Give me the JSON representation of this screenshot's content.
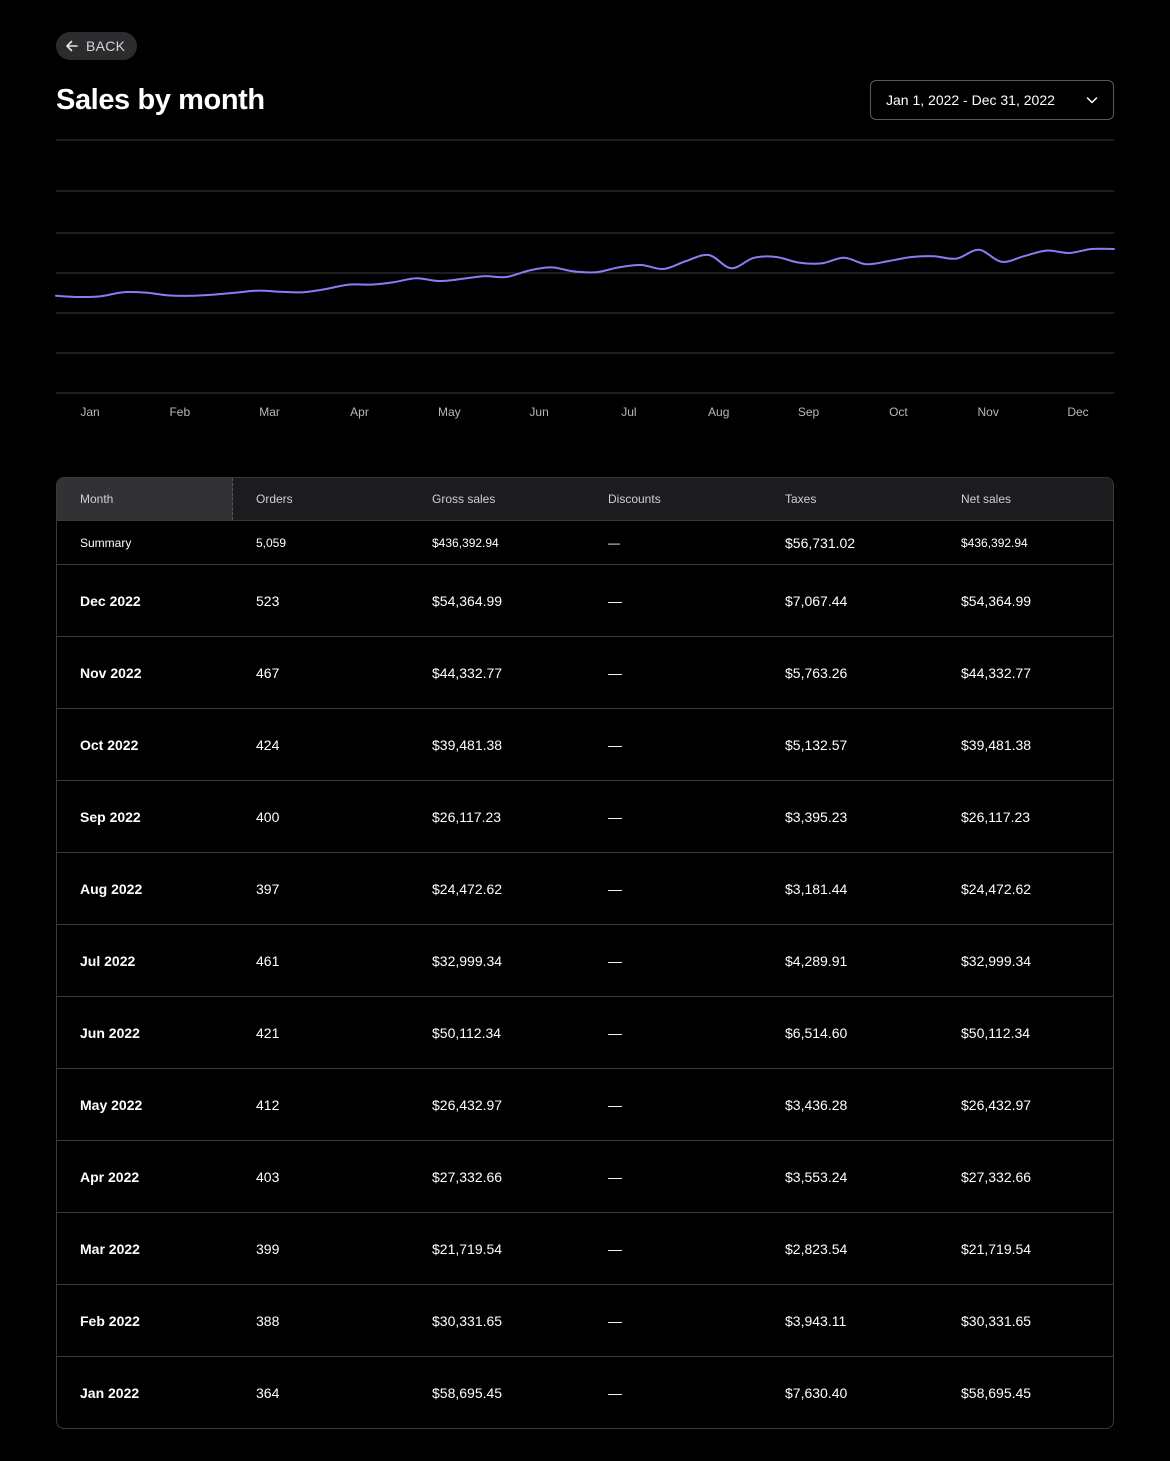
{
  "back": {
    "label": "BACK",
    "icon": "arrow-left-icon"
  },
  "page": {
    "title": "Sales by month"
  },
  "date_range": {
    "value": "Jan 1, 2022 - Dec 31, 2022",
    "icon": "chevron-down-icon"
  },
  "colors": {
    "line": "#8b7cf6",
    "grid": "#3a3a3e",
    "background": "#000000"
  },
  "chart_data": {
    "type": "line",
    "categories": [
      "Jan",
      "Feb",
      "Mar",
      "Apr",
      "May",
      "Jun",
      "Jul",
      "Aug",
      "Sep",
      "Oct",
      "Nov",
      "Dec"
    ],
    "grid": true,
    "xlabel": "",
    "ylabel": "",
    "series": [
      {
        "values": [
          0.43,
          0.4,
          0.42,
          0.52,
          0.51,
          0.44,
          0.43,
          0.46,
          0.51,
          0.56,
          0.53,
          0.52,
          0.6,
          0.71,
          0.71,
          0.77,
          0.87,
          0.8,
          0.85,
          0.92,
          0.9,
          1.06,
          1.14,
          1.04,
          1.02,
          1.14,
          1.2,
          1.1,
          1.3,
          1.45,
          1.12,
          1.38,
          1.4,
          1.26,
          1.24,
          1.38,
          1.22,
          1.3,
          1.4,
          1.42,
          1.36,
          1.58,
          1.28,
          1.42,
          1.56,
          1.5,
          1.6,
          1.6
        ]
      }
    ]
  },
  "table": {
    "headers": [
      "Month",
      "Orders",
      "Gross sales",
      "Discounts",
      "Taxes",
      "Net sales"
    ],
    "summary": [
      "Summary",
      "5,059",
      "$436,392.94",
      "—",
      "$56,731.02",
      "$436,392.94"
    ],
    "rows": [
      [
        "Dec 2022",
        "523",
        "$54,364.99",
        "—",
        "$7,067.44",
        "$54,364.99"
      ],
      [
        "Nov 2022",
        "467",
        "$44,332.77",
        "—",
        "$5,763.26",
        "$44,332.77"
      ],
      [
        "Oct 2022",
        "424",
        "$39,481.38",
        "—",
        "$5,132.57",
        "$39,481.38"
      ],
      [
        "Sep 2022",
        "400",
        "$26,117.23",
        "—",
        "$3,395.23",
        "$26,117.23"
      ],
      [
        "Aug 2022",
        "397",
        "$24,472.62",
        "—",
        "$3,181.44",
        "$24,472.62"
      ],
      [
        "Jul 2022",
        "461",
        "$32,999.34",
        "—",
        "$4,289.91",
        "$32,999.34"
      ],
      [
        "Jun 2022",
        "421",
        "$50,112.34",
        "—",
        "$6,514.60",
        "$50,112.34"
      ],
      [
        "May 2022",
        "412",
        "$26,432.97",
        "—",
        "$3,436.28",
        "$26,432.97"
      ],
      [
        "Apr 2022",
        "403",
        "$27,332.66",
        "—",
        "$3,553.24",
        "$27,332.66"
      ],
      [
        "Mar 2022",
        "399",
        "$21,719.54",
        "—",
        "$2,823.54",
        "$21,719.54"
      ],
      [
        "Feb 2022",
        "388",
        "$30,331.65",
        "—",
        "$3,943.11",
        "$30,331.65"
      ],
      [
        "Jan 2022",
        "364",
        "$58,695.45",
        "—",
        "$7,630.40",
        "$58,695.45"
      ]
    ]
  }
}
